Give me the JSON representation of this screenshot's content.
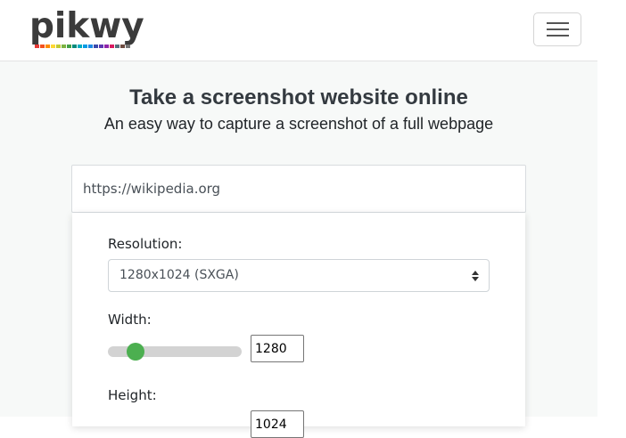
{
  "brand": {
    "name": "pikwy",
    "stripe_colors": [
      "#e53935",
      "#f4511e",
      "#fb8c00",
      "#fdd835",
      "#c0ca33",
      "#7cb342",
      "#43a047",
      "#00897b",
      "#00acc1",
      "#039be5",
      "#1e88e5",
      "#3949ab",
      "#5e35b1",
      "#8e24aa",
      "#d81b60",
      "#546e7a",
      "#6d4c41",
      "#757575"
    ]
  },
  "nav": {
    "menu_icon": "hamburger-icon"
  },
  "hero": {
    "title": "Take a screenshot website online",
    "subtitle": "An easy way to capture a screenshot of a full webpage"
  },
  "url_field": {
    "value": "https://wikipedia.org"
  },
  "options": {
    "resolution_label": "Resolution:",
    "resolution_value": "1280x1024 (SXGA)",
    "width_label": "Width:",
    "width_value": "1280",
    "width_slider_fraction": 0.16,
    "height_label": "Height:",
    "height_value": "1024"
  },
  "colors": {
    "accent_green": "#4caf50",
    "heading": "#343a40"
  }
}
